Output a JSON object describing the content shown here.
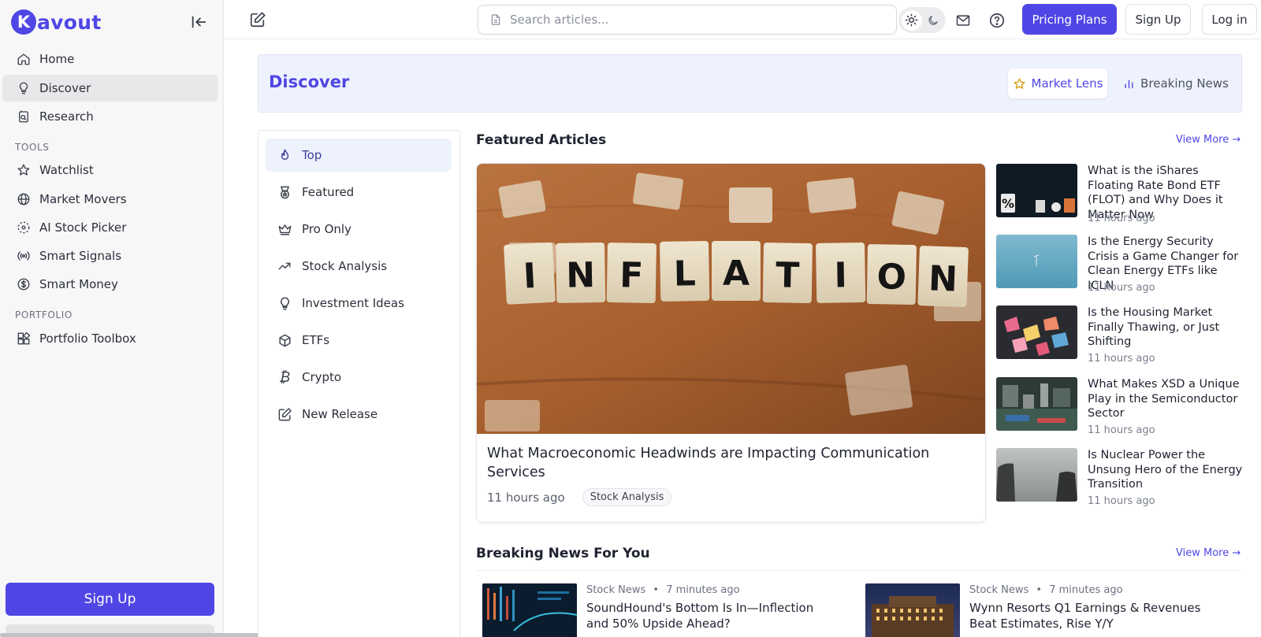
{
  "brand": {
    "logo_letter": "K",
    "logo_text": "avout",
    "accent": "#4f46e5"
  },
  "sidebar": {
    "collapse_icon": "collapse-left-icon",
    "main_items": [
      {
        "label": "Home",
        "icon": "home-icon"
      },
      {
        "label": "Discover",
        "icon": "lightbulb-icon",
        "active": true
      },
      {
        "label": "Research",
        "icon": "research-icon"
      }
    ],
    "tools_heading": "TOOLS",
    "tools_items": [
      {
        "label": "Watchlist",
        "icon": "star-icon"
      },
      {
        "label": "Market Movers",
        "icon": "globe-icon"
      },
      {
        "label": "AI Stock Picker",
        "icon": "ai-picker-icon"
      },
      {
        "label": "Smart Signals",
        "icon": "signal-icon"
      },
      {
        "label": "Smart Money",
        "icon": "dollar-icon"
      }
    ],
    "portfolio_heading": "PORTFOLIO",
    "portfolio_items": [
      {
        "label": "Portfolio Toolbox",
        "icon": "toolbox-icon"
      }
    ],
    "signup_label": "Sign Up"
  },
  "topbar": {
    "search_placeholder": "Search articles...",
    "theme": {
      "light_icon": "sun-icon",
      "dark_icon": "moon-icon",
      "selected": "light"
    },
    "mail_icon": "mail-icon",
    "help_icon": "help-icon",
    "pricing_label": "Pricing Plans",
    "signup_label": "Sign Up",
    "login_label": "Log in"
  },
  "banner": {
    "title": "Discover",
    "tabs": [
      {
        "label": "Market Lens",
        "icon": "star-icon",
        "active": true
      },
      {
        "label": "Breaking News",
        "icon": "bar-chart-icon"
      }
    ]
  },
  "categories": [
    {
      "label": "Top",
      "icon": "flame-icon",
      "active": true
    },
    {
      "label": "Featured",
      "icon": "medal-icon"
    },
    {
      "label": "Pro Only",
      "icon": "crown-icon"
    },
    {
      "label": "Stock Analysis",
      "icon": "trend-up-icon"
    },
    {
      "label": "Investment Ideas",
      "icon": "lightbulb-icon"
    },
    {
      "label": "ETFs",
      "icon": "box-icon"
    },
    {
      "label": "Crypto",
      "icon": "bitcoin-icon"
    },
    {
      "label": "New Release",
      "icon": "edit-icon"
    }
  ],
  "featured": {
    "heading": "Featured Articles",
    "view_more": "View More →",
    "main": {
      "image_letters": [
        "I",
        "N",
        "F",
        "L",
        "A",
        "T",
        "I",
        "O",
        "N"
      ],
      "title": "What Macroeconomic Headwinds are Impacting Communication Services",
      "time": "11 hours ago",
      "tag": "Stock Analysis"
    },
    "side": [
      {
        "title": "What is the iShares Floating Rate Bond ETF (FLOT) and Why Does it Matter Now",
        "time": "11 hours ago"
      },
      {
        "title": "Is the Energy Security Crisis a Game Changer for Clean Energy ETFs like ICLN",
        "time": "11 hours ago"
      },
      {
        "title": "Is the Housing Market Finally Thawing, or Just Shifting",
        "time": "11 hours ago"
      },
      {
        "title": "What Makes XSD a Unique Play in the Semiconductor Sector",
        "time": "11 hours ago"
      },
      {
        "title": "Is Nuclear Power the Unsung Hero of the Energy Transition",
        "time": "11 hours ago"
      }
    ]
  },
  "breaking": {
    "heading": "Breaking News For You",
    "view_more": "View More →",
    "items": [
      {
        "source": "Stock News",
        "sep": "•",
        "time": "7 minutes ago",
        "title": "SoundHound's Bottom Is In—Inflection and 50% Upside Ahead?"
      },
      {
        "source": "Stock News",
        "sep": "•",
        "time": "7 minutes ago",
        "title": "Wynn Resorts Q1 Earnings & Revenues Beat Estimates, Rise Y/Y"
      }
    ]
  }
}
